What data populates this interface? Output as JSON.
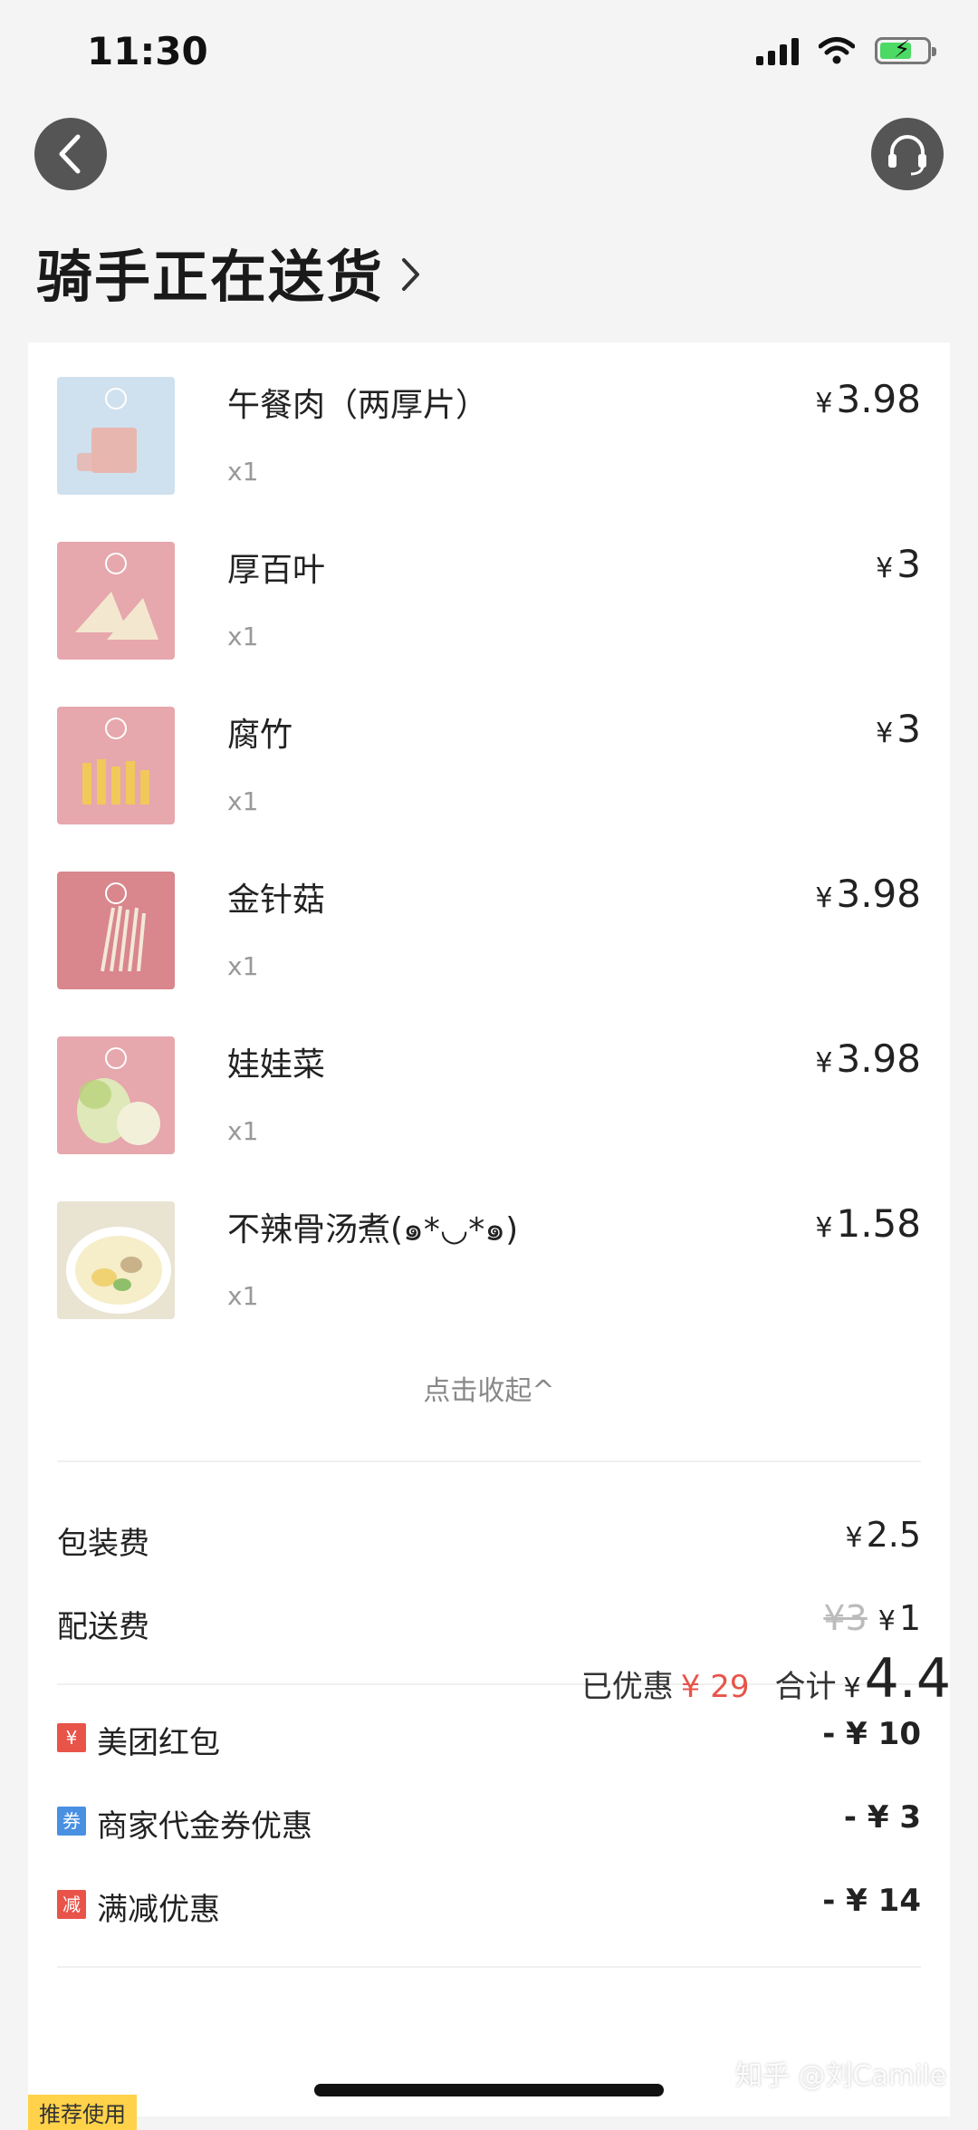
{
  "status_bar": {
    "time": "11:30"
  },
  "header": {
    "title": "骑手正在送货"
  },
  "items": [
    {
      "name": "午餐肉（两厚片）",
      "qty": "x1",
      "currency": "¥",
      "price": "3.98",
      "thumb_color": "#cfe0ee",
      "food_color": "#e7b6ae"
    },
    {
      "name": "厚百叶",
      "qty": "x1",
      "currency": "¥",
      "price": "3",
      "thumb_color": "#e6a7ad",
      "food_color": "#f3e8cf"
    },
    {
      "name": "腐竹",
      "qty": "x1",
      "currency": "¥",
      "price": "3",
      "thumb_color": "#e6a7ad",
      "food_color": "#f1c85a"
    },
    {
      "name": "金针菇",
      "qty": "x1",
      "currency": "¥",
      "price": "3.98",
      "thumb_color": "#d9868d",
      "food_color": "#f2e9d8"
    },
    {
      "name": "娃娃菜",
      "qty": "x1",
      "currency": "¥",
      "price": "3.98",
      "thumb_color": "#e6a7ad",
      "food_color": "#dfe8b8"
    },
    {
      "name": "不辣骨汤煮(๑*◡*๑)",
      "qty": "x1",
      "currency": "¥",
      "price": "1.58",
      "thumb_color": "#e9e3d2",
      "food_color": "#f0d272"
    }
  ],
  "collapse_label": "点击收起^",
  "fees": {
    "packaging": {
      "label": "包装费",
      "currency": "¥",
      "value": "2.5"
    },
    "delivery": {
      "label": "配送费",
      "original": "¥3",
      "currency": "¥",
      "value": "1"
    }
  },
  "discounts": [
    {
      "tag": "¥",
      "tag_color": "#e8544a",
      "label": "美团红包",
      "value": "- ¥ 10"
    },
    {
      "tag": "券",
      "tag_color": "#4a90e2",
      "label": "商家代金券优惠",
      "value": "- ¥ 3"
    },
    {
      "tag": "减",
      "tag_color": "#e8544a",
      "label": "满减优惠",
      "value": "- ¥ 14"
    }
  ],
  "summary": {
    "saved_label": "已优惠",
    "saved_value": "¥ 29",
    "total_label": "合计",
    "total_currency": "¥",
    "total_value": "4.4"
  },
  "recommend_label": "推荐使用",
  "watermark": "知乎 @刘Camile"
}
